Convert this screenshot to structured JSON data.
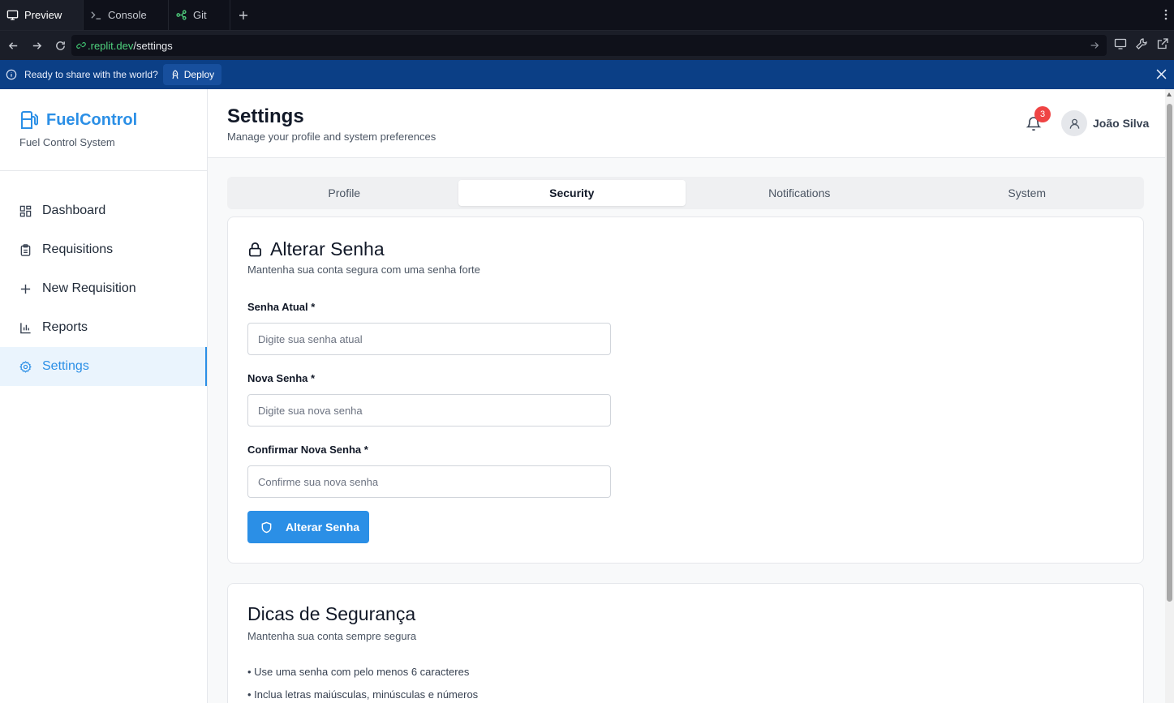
{
  "browser": {
    "tabs": [
      {
        "label": "Preview",
        "icon": "monitor-icon"
      },
      {
        "label": "Console",
        "icon": "terminal-icon"
      },
      {
        "label": "Git",
        "icon": "git-icon"
      }
    ],
    "url_host": ".replit.dev",
    "url_path": "/settings",
    "deploy_message": "Ready to share with the world?",
    "deploy_label": "Deploy"
  },
  "sidebar": {
    "brand": "FuelControl",
    "subtitle": "Fuel Control System",
    "items": [
      {
        "label": "Dashboard",
        "icon": "grid-icon"
      },
      {
        "label": "Requisitions",
        "icon": "clipboard-icon"
      },
      {
        "label": "New Requisition",
        "icon": "plus-icon"
      },
      {
        "label": "Reports",
        "icon": "bar-chart-icon"
      },
      {
        "label": "Settings",
        "icon": "gear-icon",
        "active": true
      }
    ]
  },
  "header": {
    "title": "Settings",
    "subtitle": "Manage your profile and system preferences",
    "notification_count": "3",
    "user_name": "João Silva"
  },
  "tabs": [
    {
      "label": "Profile"
    },
    {
      "label": "Security",
      "active": true
    },
    {
      "label": "Notifications"
    },
    {
      "label": "System"
    }
  ],
  "password_card": {
    "title": "Alterar Senha",
    "description": "Mantenha sua conta segura com uma senha forte",
    "fields": [
      {
        "label": "Senha Atual *",
        "placeholder": "Digite sua senha atual",
        "value": ""
      },
      {
        "label": "Nova Senha *",
        "placeholder": "Digite sua nova senha",
        "value": ""
      },
      {
        "label": "Confirmar Nova Senha *",
        "placeholder": "Confirme sua nova senha",
        "value": ""
      }
    ],
    "button_label": "Alterar Senha"
  },
  "tips_card": {
    "title": "Dicas de Segurança",
    "description": "Mantenha sua conta sempre segura",
    "tips": [
      "• Use uma senha com pelo menos 6 caracteres",
      "• Inclua letras maiúsculas, minúsculas e números"
    ]
  },
  "colors": {
    "accent": "#2b8fe6",
    "badge": "#ef4444",
    "deploy_bar": "#0b3f86"
  }
}
